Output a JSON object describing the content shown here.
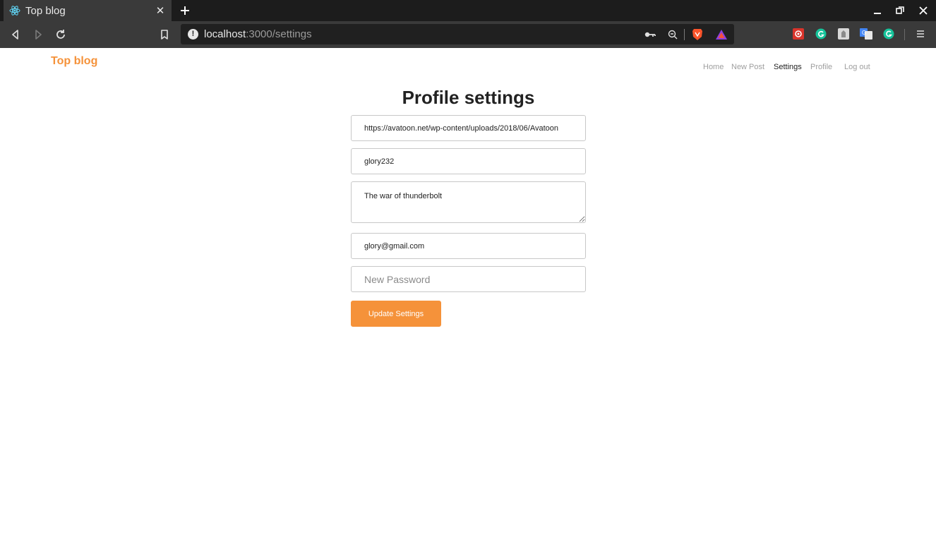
{
  "browser": {
    "tab_title": "Top blog",
    "url_host": "localhost",
    "url_path": ":3000/settings"
  },
  "site": {
    "brand": "Top blog",
    "nav": {
      "home": "Home",
      "new_post": "New Post",
      "settings": "Settings",
      "profile": "Profile",
      "logout": "Log out"
    }
  },
  "form": {
    "title": "Profile settings",
    "image_url": "https://avatoon.net/wp-content/uploads/2018/06/Avatoon",
    "username": "glory232",
    "bio": "The war of thunderbolt",
    "email": "glory@gmail.com",
    "password_placeholder": "New Password",
    "submit_label": "Update Settings"
  },
  "colors": {
    "accent": "#f5923a",
    "chrome_dark": "#1c1c1c",
    "chrome": "#3a3a3a"
  }
}
